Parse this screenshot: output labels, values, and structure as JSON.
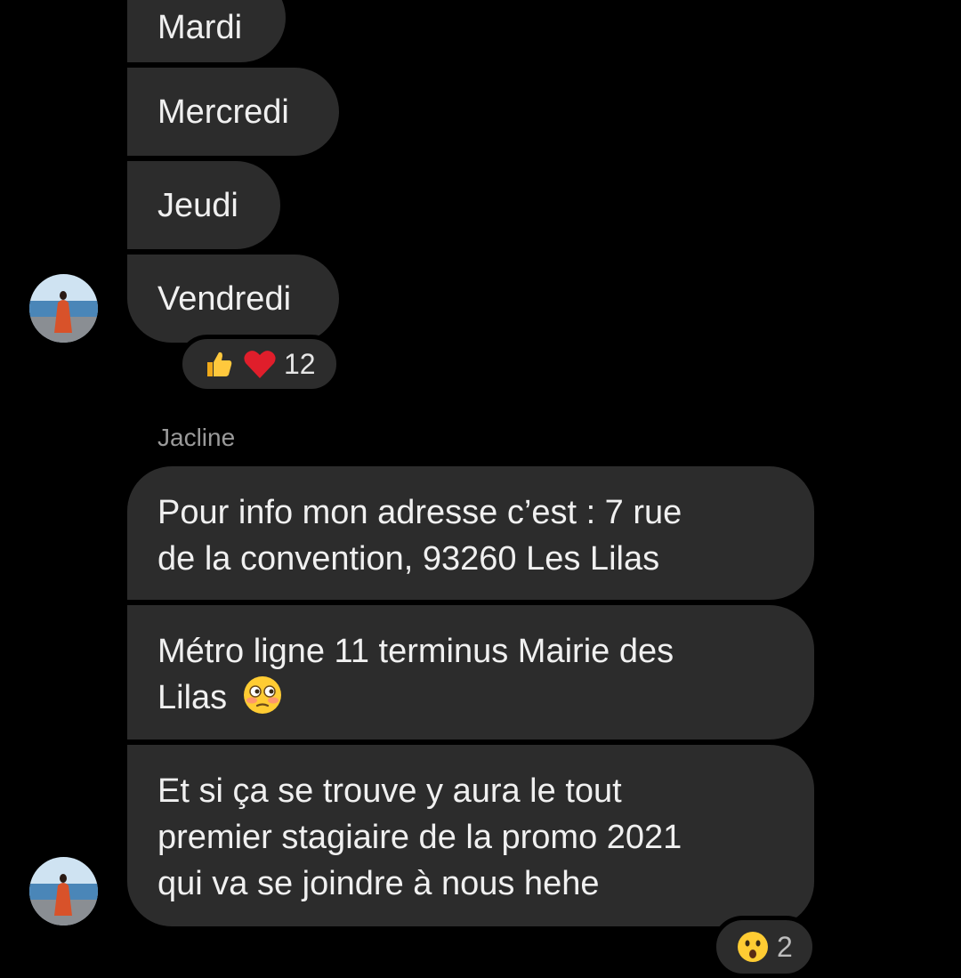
{
  "messages_previous": [
    {
      "text": "Mardi"
    },
    {
      "text": "Mercredi"
    },
    {
      "text": "Jeudi"
    },
    {
      "text": "Vendredi"
    }
  ],
  "reactions_previous": {
    "emojis": [
      "thumbs-up",
      "red-heart"
    ],
    "count": "12"
  },
  "jacline": {
    "sender_name": "Jacline",
    "messages": [
      {
        "line1": "Pour info mon adresse c’est : 7 rue",
        "line2": "de la convention, 93260 Les Lilas"
      },
      {
        "line1": "Métro ligne 11 terminus Mairie des",
        "line2": "Lilas",
        "emoji": "flushed-face"
      },
      {
        "line1": "Et si ça se trouve y aura le tout",
        "line2": "premier stagiaire de la promo 2021",
        "line3": "qui va se joindre à nous hehe"
      }
    ],
    "reaction": {
      "emoji": "surprised-face",
      "count": "2"
    }
  },
  "colors": {
    "background": "#000000",
    "bubble": "#2c2c2c",
    "text": "#f0f0f0",
    "sender_name": "#9a9a9a"
  }
}
